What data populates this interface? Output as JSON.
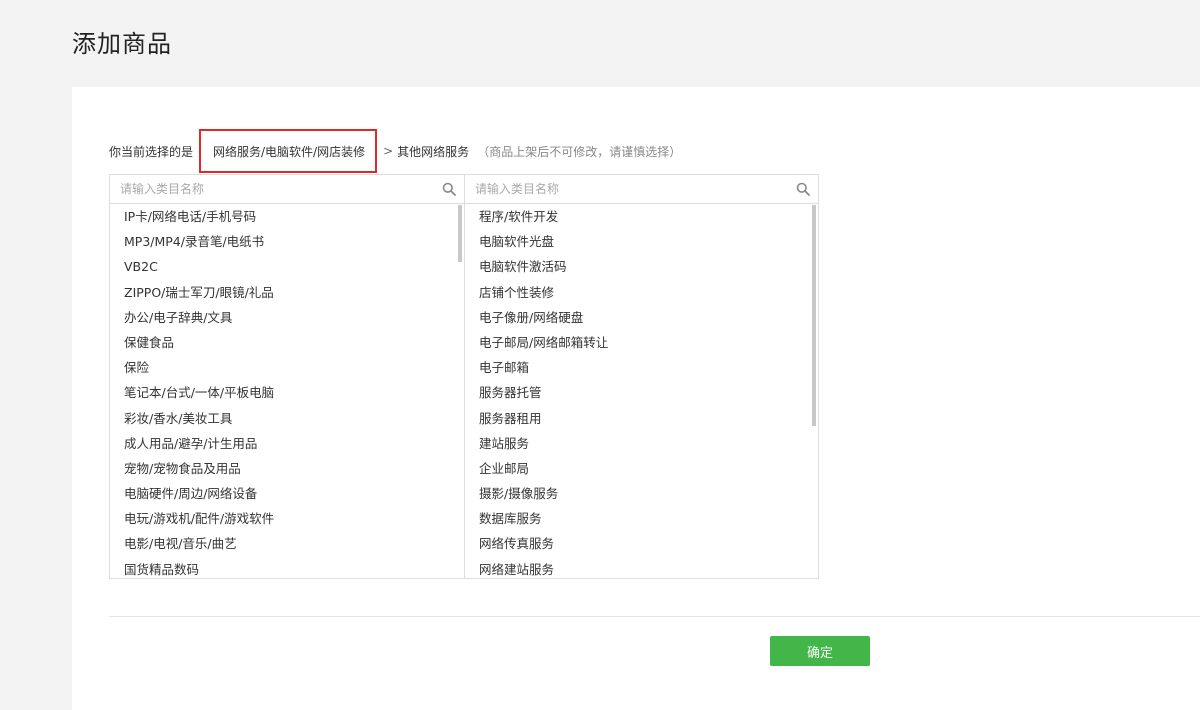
{
  "page": {
    "title": "添加商品"
  },
  "selection": {
    "prefix": "你当前选择的是",
    "path": "网络服务/电脑软件/网店装修",
    "separator": ">",
    "current": "其他网络服务",
    "note": "（商品上架后不可修改，请谨慎选择）"
  },
  "left_panel": {
    "search_placeholder": "请输入类目名称",
    "items": [
      "IP卡/网络电话/手机号码",
      "MP3/MP4/录音笔/电纸书",
      "VB2C",
      "ZIPPO/瑞士军刀/眼镜/礼品",
      "办公/电子辞典/文具",
      "保健食品",
      "保险",
      "笔记本/台式/一体/平板电脑",
      "彩妆/香水/美妆工具",
      "成人用品/避孕/计生用品",
      "宠物/宠物食品及用品",
      "电脑硬件/周边/网络设备",
      "电玩/游戏机/配件/游戏软件",
      "电影/电视/音乐/曲艺",
      "国货精品数码"
    ]
  },
  "right_panel": {
    "search_placeholder": "请输入类目名称",
    "items": [
      "程序/软件开发",
      "电脑软件光盘",
      "电脑软件激活码",
      "店铺个性装修",
      "电子像册/网络硬盘",
      "电子邮局/网络邮箱转让",
      "电子邮箱",
      "服务器托管",
      "服务器租用",
      "建站服务",
      "企业邮局",
      "摄影/摄像服务",
      "数据库服务",
      "网络传真服务",
      "网络建站服务"
    ]
  },
  "footer": {
    "confirm_label": "确定"
  },
  "colors": {
    "accent": "#43b649",
    "highlight_border": "#e02a2a"
  }
}
